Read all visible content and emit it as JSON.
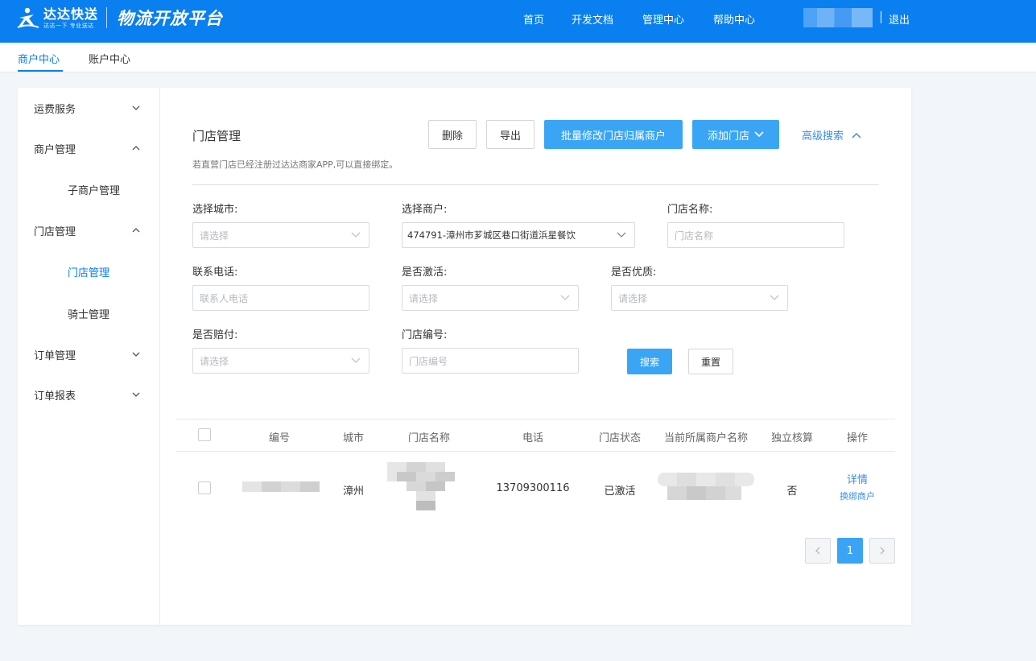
{
  "header": {
    "brand_name": "达达快送",
    "brand_slogan": "达达一下 专业送达",
    "platform_name": "物流开放平台",
    "nav": [
      "首页",
      "开发文档",
      "管理中心",
      "帮助中心"
    ],
    "logout_label": "退出",
    "brand_color": "#0a7ff0"
  },
  "subnav": {
    "tabs": [
      "商户中心",
      "账户中心"
    ],
    "active_index": 0
  },
  "sidebar": {
    "items": [
      {
        "label": "运费服务",
        "level": 1,
        "expanded": false
      },
      {
        "label": "商户管理",
        "level": 1,
        "expanded": true
      },
      {
        "label": "子商户管理",
        "level": 2
      },
      {
        "label": "门店管理",
        "level": 1,
        "expanded": true
      },
      {
        "label": "门店管理",
        "level": 2,
        "active": true
      },
      {
        "label": "骑士管理",
        "level": 2
      },
      {
        "label": "订单管理",
        "level": 1,
        "expanded": false
      },
      {
        "label": "订单报表",
        "level": 1,
        "expanded": false
      }
    ]
  },
  "main": {
    "title": "门店管理",
    "hint": "若直营门店已经注册过达达商家APP,可以直接绑定。",
    "buttons": {
      "delete": "删除",
      "export": "导出",
      "batch_modify": "批量修改门店归属商户",
      "add_store": "添加门店",
      "advanced_search": "高级搜索"
    },
    "filters": {
      "city_label": "选择城市:",
      "city_placeholder": "请选择",
      "merchant_label": "选择商户:",
      "merchant_value": "474791-漳州市芗城区巷口街道浜星餐饮",
      "store_name_label": "门店名称:",
      "store_name_placeholder": "门店名称",
      "phone_label": "联系电话:",
      "phone_placeholder": "联系人电话",
      "activated_label": "是否激活:",
      "activated_placeholder": "请选择",
      "quality_label": "是否优质:",
      "quality_placeholder": "请选择",
      "compensation_label": "是否赔付:",
      "compensation_placeholder": "请选择",
      "store_no_label": "门店编号:",
      "store_no_placeholder": "门店编号",
      "search_button": "搜索",
      "reset_button": "重置"
    },
    "table": {
      "columns": [
        "编号",
        "城市",
        "门店名称",
        "电话",
        "门店状态",
        "当前所属商户名称",
        "独立核算",
        "操作"
      ],
      "rows": [
        {
          "city": "漳州",
          "phone": "13709300116",
          "status": "已激活",
          "independent": "否",
          "action_detail": "详情",
          "action_change": "换绑商户"
        }
      ]
    },
    "pagination": {
      "current_page": "1",
      "prev_icon": "chevron-left-icon",
      "next_icon": "chevron-right-icon"
    }
  }
}
